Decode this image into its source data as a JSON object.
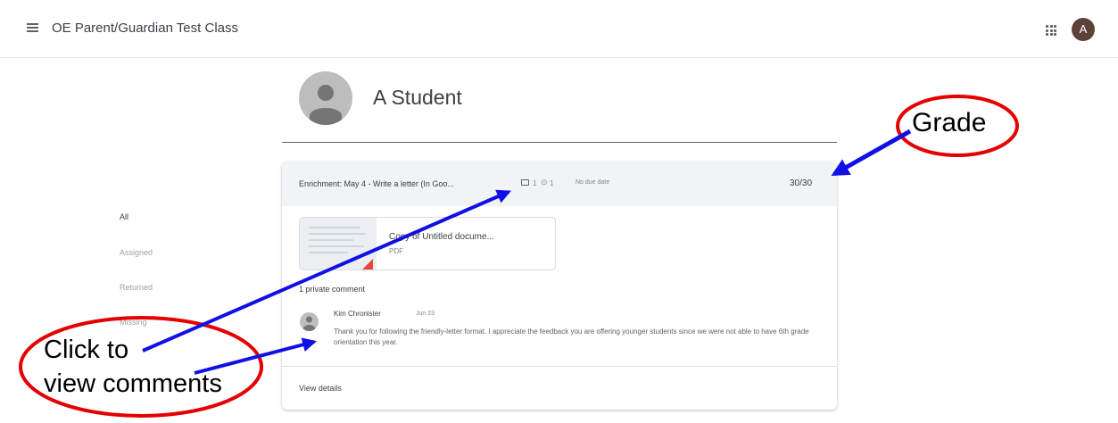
{
  "header": {
    "menu_icon": "hamburger-menu-icon",
    "class_title": "OE Parent/Guardian Test Class",
    "apps_icon": "apps-grid-icon",
    "avatar_letter": "A"
  },
  "student": {
    "name": "A Student",
    "avatar_icon": "person-icon"
  },
  "sidebar": {
    "items": [
      {
        "label": "All",
        "active": true
      },
      {
        "label": "Assigned",
        "active": false
      },
      {
        "label": "Returned",
        "active": false
      },
      {
        "label": "Missing",
        "active": false
      }
    ]
  },
  "assignment": {
    "title": "Enrichment: May 4 - Write a letter (In Goo...",
    "comment_count": "1",
    "attachment_count": "1",
    "due": "No due date",
    "grade": "30/30",
    "attachment": {
      "title": "Copy of Untitled docume...",
      "type": "PDF"
    },
    "private_comments_label": "1 private comment",
    "comment": {
      "author": "Kim Chronister",
      "date": "Jun 23",
      "text": "Thank you for following the friendly-letter format.  I appreciate the feedback you are offering younger students since we were not able to have 6th grade orientation this year."
    },
    "view_details": "View details"
  },
  "annotations": {
    "grade_label": "Grade",
    "comments_label_line1": "Click to",
    "comments_label_line2": "view comments",
    "ellipse_color": "#e50000",
    "arrow_color": "#1010e6"
  }
}
